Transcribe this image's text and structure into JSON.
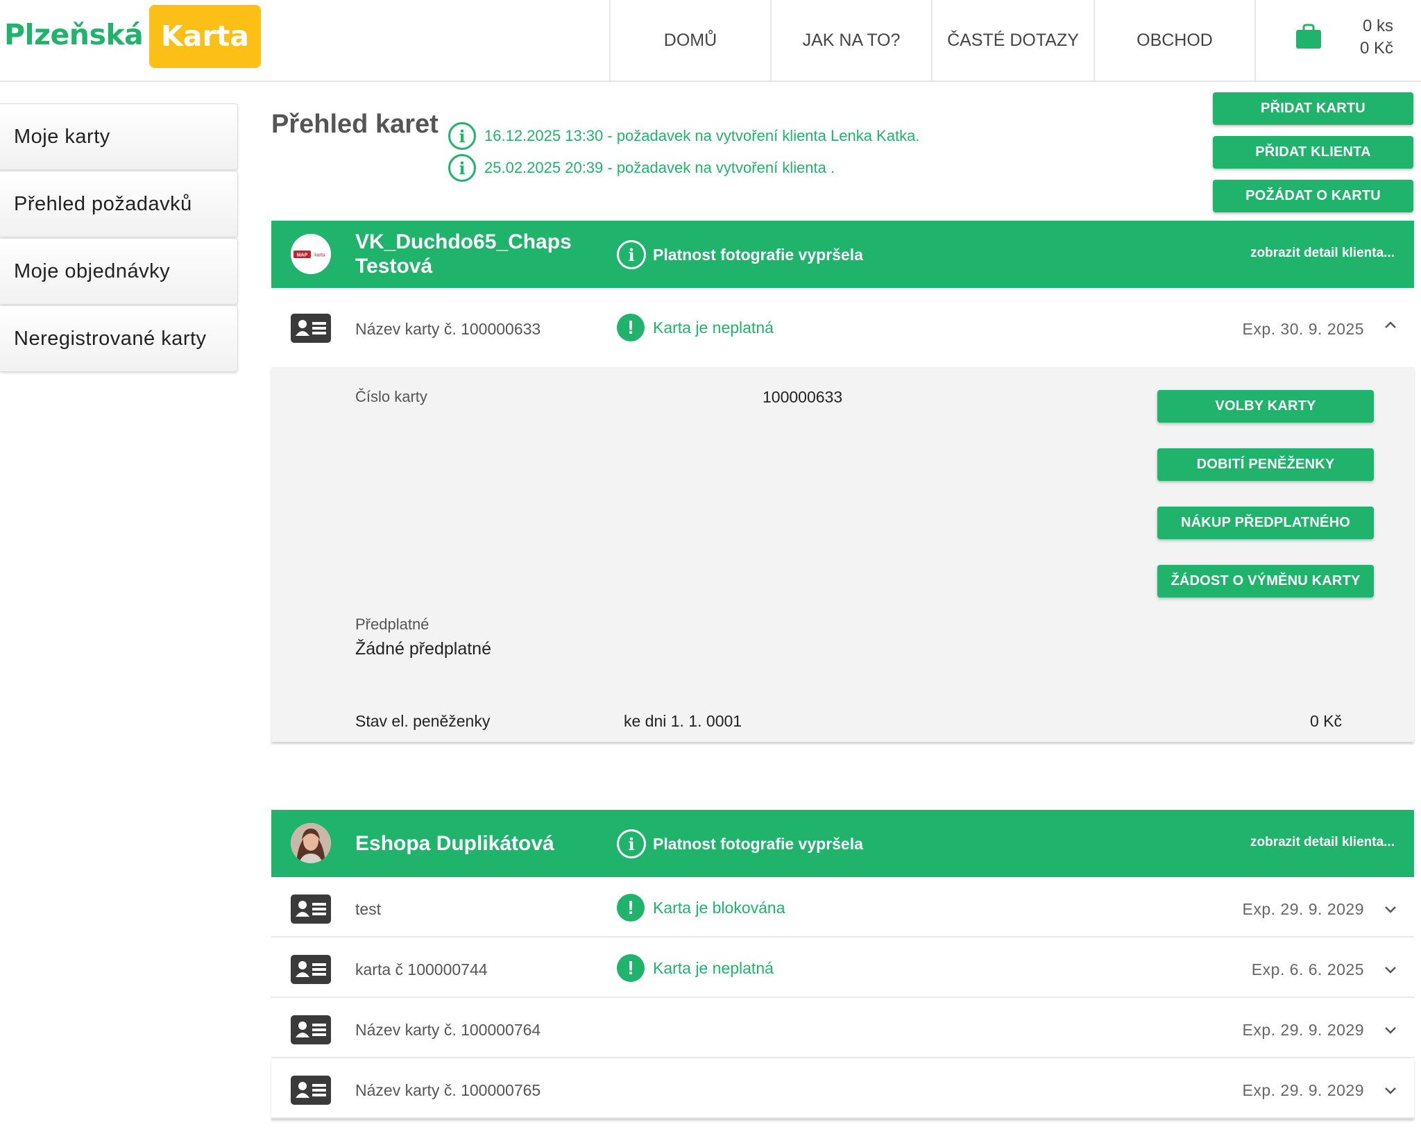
{
  "brand": {
    "name_part1": "Plzeňská",
    "name_part2": "Karta"
  },
  "nav": [
    "DOMŮ",
    "JAK NA TO?",
    "ČASTÉ DOTAZY",
    "OBCHOD"
  ],
  "cart": {
    "count": "0 ks",
    "total": "0 Kč"
  },
  "sidebar": [
    "Moje karty",
    "Přehled požadavků",
    "Moje objednávky",
    "Neregistrované karty"
  ],
  "page_title": "Přehled karet",
  "notices": [
    "16.12.2025 13:30 - požadavek na vytvoření klienta Lenka Katka.",
    "25.02.2025 20:39 - požadavek na vytvoření klienta ."
  ],
  "actions": [
    "PŘIDAT KARTU",
    "PŘIDAT KLIENTA",
    "POŽÁDAT O KARTU"
  ],
  "clients": [
    {
      "name_line1": "VK_Duchdo65_Chaps",
      "name_line2": "Testová",
      "notice": "Platnost fotografie vypršela",
      "detail_link": "zobrazit detail klienta...",
      "avatar_logo": "MAP karta",
      "cards": [
        {
          "name": "Název karty č. 100000633",
          "status": "Karta je neplatná",
          "exp": "Exp. 30. 9. 2025"
        }
      ]
    },
    {
      "name_line1": "Eshopa Duplikátová",
      "notice": "Platnost fotografie vypršela",
      "detail_link": "zobrazit detail klienta...",
      "cards": [
        {
          "name": "test",
          "status": "Karta je blokována",
          "exp": "Exp. 29. 9. 2029"
        },
        {
          "name": "karta č 100000744",
          "status": "Karta je neplatná",
          "exp": "Exp. 6. 6. 2025"
        },
        {
          "name": "Název karty č. 100000764",
          "exp": "Exp. 29. 9. 2029"
        },
        {
          "name": "Název karty č. 100000765",
          "exp": "Exp. 29. 9. 2029"
        }
      ]
    }
  ],
  "card_detail": {
    "number_label": "Číslo karty",
    "number_value": "100000633",
    "subscription_label": "Předplatné",
    "subscription_value": "Žádné předplatné",
    "wallet_label": "Stav el. peněženky",
    "wallet_date": "ke dni 1. 1. 0001",
    "wallet_amount": "0 Kč",
    "buttons": [
      "VOLBY KARTY",
      "DOBITÍ PENĚŽENKY",
      "NÁKUP PŘEDPLATNÉHO",
      "ŽÁDOST O VÝMĚNU KARTY"
    ]
  },
  "colors": {
    "brand_green": "#1fb36b",
    "brand_yellow": "#fbbf16"
  },
  "icons": [
    "shopping-bag-icon",
    "info-icon",
    "exclamation-icon",
    "id-card-icon",
    "chevron-up-icon",
    "chevron-down-icon"
  ]
}
